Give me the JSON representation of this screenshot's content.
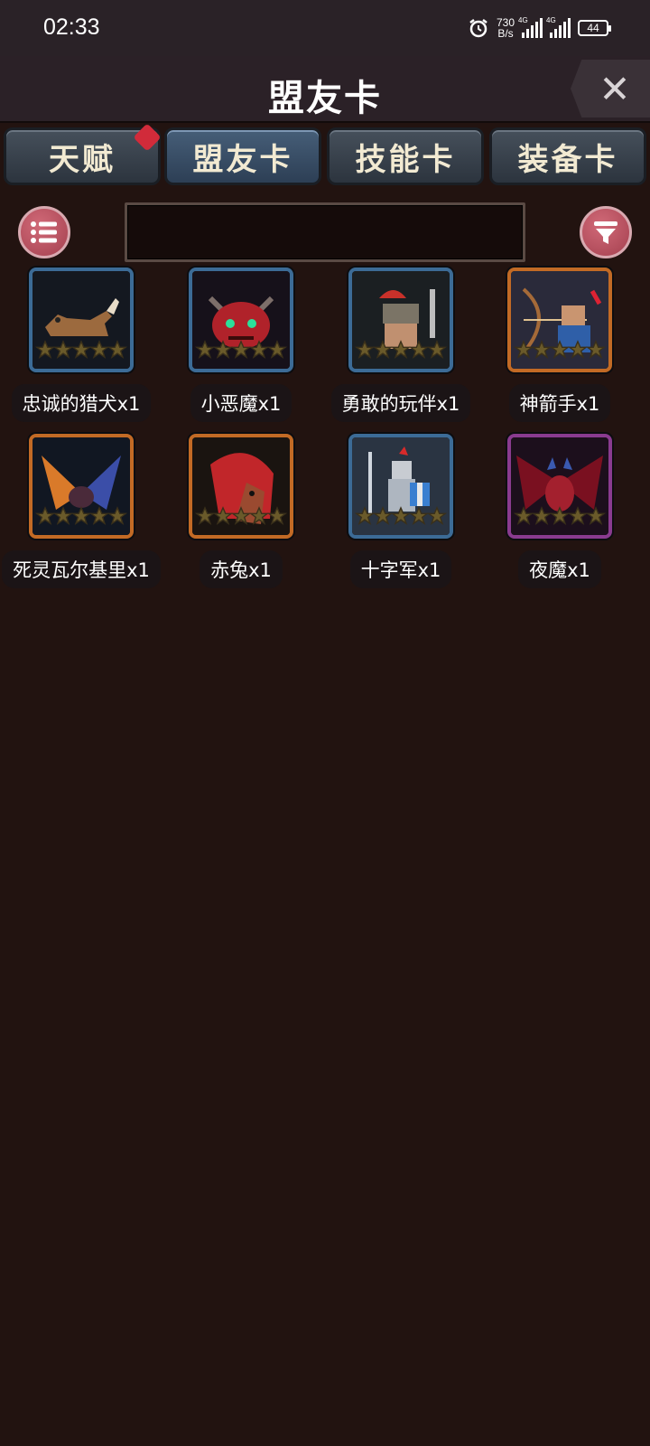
{
  "status_bar": {
    "time": "02:33",
    "net_speed_value": "730",
    "net_speed_unit": "B/s",
    "sim1_tag": "4G",
    "sim2_tag": "4G",
    "battery": "44"
  },
  "header": {
    "title": "盟友卡"
  },
  "tabs": [
    {
      "label": "天赋",
      "active": false,
      "badge": true
    },
    {
      "label": "盟友卡",
      "active": true,
      "badge": false
    },
    {
      "label": "技能卡",
      "active": false,
      "badge": false
    },
    {
      "label": "装备卡",
      "active": false,
      "badge": false
    }
  ],
  "search": {
    "value": "",
    "placeholder": ""
  },
  "cards": [
    {
      "label": "忠诚的猎犬x1",
      "frame": "blue",
      "art": "hound"
    },
    {
      "label": "小恶魔x1",
      "frame": "blue",
      "art": "imp"
    },
    {
      "label": "勇敢的玩伴x1",
      "frame": "blue",
      "art": "warrior"
    },
    {
      "label": "神箭手x1",
      "frame": "orange",
      "art": "archer"
    },
    {
      "label": "死灵瓦尔基里x1",
      "frame": "orange",
      "art": "valkyrie"
    },
    {
      "label": "赤兔x1",
      "frame": "orange",
      "art": "horse"
    },
    {
      "label": "十字军x1",
      "frame": "blue",
      "art": "crusader"
    },
    {
      "label": "夜魔x1",
      "frame": "purple",
      "art": "night-demon"
    }
  ],
  "colors": {
    "background": "#221310",
    "frame_blue": "#3c6b96",
    "frame_orange": "#c26a25",
    "frame_purple": "#8a3b8f",
    "button_red": "#a4404f",
    "badge_red": "#d12b3a"
  }
}
